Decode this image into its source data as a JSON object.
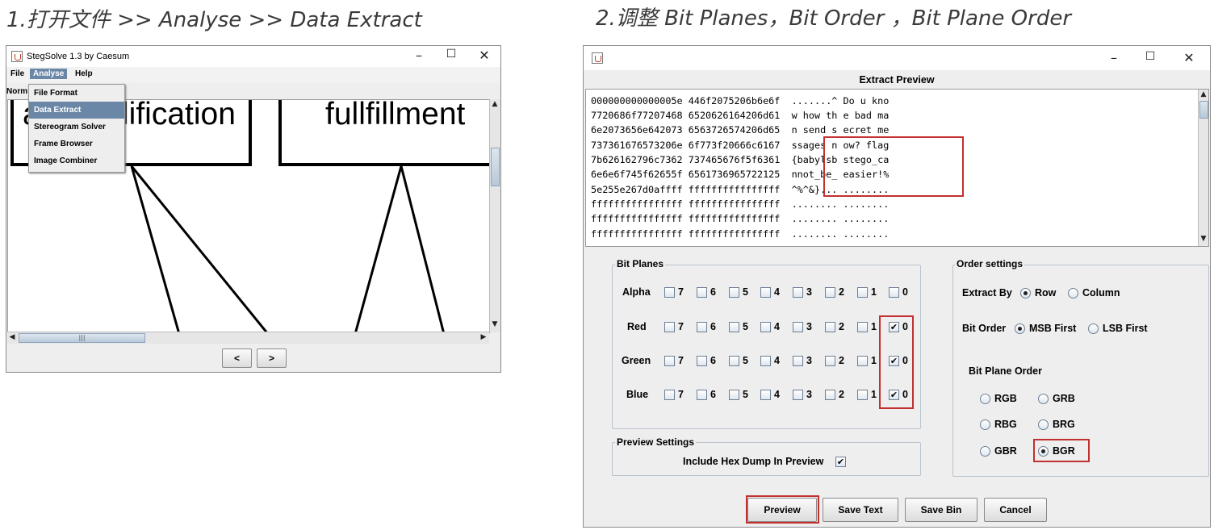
{
  "captions": {
    "left": "1.打开文件 >> Analyse >> Data Extract",
    "right": "2.调整 Bit Planes，Bit Order ，Bit Plane Order"
  },
  "left_window": {
    "title": "StegSolve 1.3 by Caesum",
    "controls": {
      "minimize": "–",
      "maximize": "☐",
      "close": "✕"
    },
    "menu": [
      "File",
      "Analyse",
      "Help"
    ],
    "dropdown": [
      "File Format",
      "Data Extract",
      "Stereogram Solver",
      "Frame Browser",
      "Image Combiner"
    ],
    "selected_dropdown": "Data Extract",
    "partial_label": "Norm",
    "canvas_words": {
      "first_partial": "a",
      "first": "lification",
      "second": "fullfillment"
    },
    "nav_buttons": {
      "prev": "<",
      "next": ">"
    },
    "scroll_grip": "|||"
  },
  "right_window": {
    "title": "Extract Preview",
    "controls": {
      "minimize": "–",
      "maximize": "☐",
      "close": "✕"
    },
    "hex_lines": [
      "000000000000005e 446f2075206b6e6f  .......^ Do u kno",
      "7720686f77207468 6520626164206d61  w how th e bad ma",
      "6e2073656e642073 6563726574206d65  n send s ecret me",
      "737361676573206e 6f773f20666c6167  ssages n ow? flag",
      "7b626162796c7362 737465676f5f6361  {babylsb stego_ca",
      "6e6e6f745f62655f 6561736965722125  nnot_be_ easier!%",
      "5e255e267d0affff ffffffffffffffff  ^%^&}... ........",
      "ffffffffffffffff ffffffffffffffff  ........ ........",
      "ffffffffffffffff ffffffffffffffff  ........ ........",
      "ffffffffffffffff ffffffffffffffff  ........ ........"
    ],
    "bit_planes": {
      "title": "Bit Planes",
      "bits": [
        "7",
        "6",
        "5",
        "4",
        "3",
        "2",
        "1",
        "0"
      ],
      "rows": [
        {
          "name": "Alpha",
          "checked_bits": []
        },
        {
          "name": "Red",
          "checked_bits": [
            "0"
          ]
        },
        {
          "name": "Green",
          "checked_bits": [
            "0"
          ]
        },
        {
          "name": "Blue",
          "checked_bits": [
            "0"
          ]
        }
      ]
    },
    "preview_settings": {
      "title": "Preview Settings",
      "hex_dump_label": "Include Hex Dump In Preview",
      "hex_dump_checked": true
    },
    "order_settings": {
      "title": "Order settings",
      "extract_by_label": "Extract By",
      "extract_by_options": [
        "Row",
        "Column"
      ],
      "extract_by_selected": "Row",
      "bit_order_label": "Bit Order",
      "bit_order_options": [
        "MSB First",
        "LSB First"
      ],
      "bit_order_selected": "MSB First",
      "plane_order_label": "Bit Plane Order",
      "plane_order_options": [
        "RGB",
        "GRB",
        "RBG",
        "BRG",
        "GBR",
        "BGR"
      ],
      "plane_order_selected": "BGR"
    },
    "buttons": [
      "Preview",
      "Save Text",
      "Save Bin",
      "Cancel"
    ]
  },
  "colors": {
    "highlight_box": "#c23030",
    "menu_select": "#6b87a8",
    "panel_bg": "#eeeeee"
  }
}
